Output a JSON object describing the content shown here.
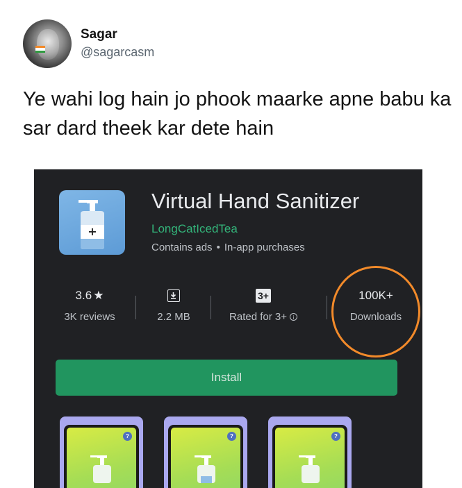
{
  "tweet": {
    "name": "Sagar",
    "handle": "@sagarcasm",
    "text": "Ye wahi log hain jo phook maarke apne babu ka sar dard theek kar dete hain"
  },
  "app": {
    "title": "Virtual Hand Sanitizer",
    "developer": "LongCatIcedTea",
    "meta_ads": "Contains ads",
    "meta_dot": "•",
    "meta_purchases": "In-app purchases",
    "stats": {
      "rating_value": "3.6",
      "rating_star": "★",
      "rating_label": "3K reviews",
      "size_label": "2.2 MB",
      "content_badge": "3+",
      "content_label": "Rated for 3+",
      "downloads_value": "100K+",
      "downloads_label": "Downloads"
    },
    "install_label": "Install",
    "screenshot_badge": "?"
  },
  "colors": {
    "store_bg": "#202124",
    "developer_green": "#33b47a",
    "install_green": "#21955f",
    "annotation_orange": "#f28a2a"
  },
  "icons": [
    "avatar",
    "sanitizer-bottle-icon",
    "download-size-icon",
    "rating-badge-icon",
    "info-icon",
    "help-icon"
  ]
}
